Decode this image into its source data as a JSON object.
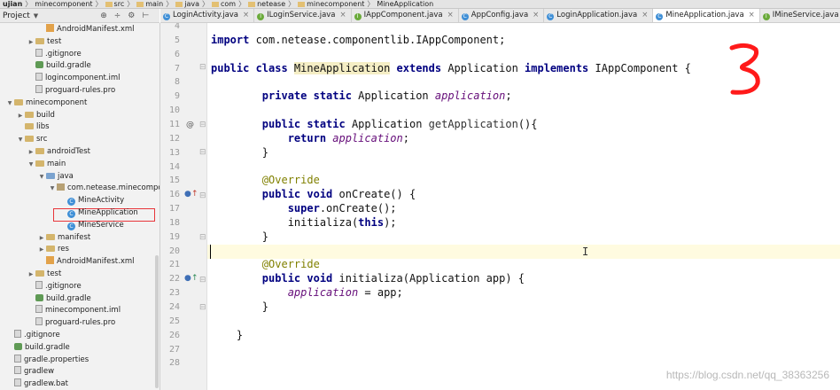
{
  "breadcrumb": [
    "ujian",
    "minecomponent",
    "src",
    "main",
    "java",
    "com",
    "netease",
    "minecomponent",
    "MineApplication"
  ],
  "project_panel": {
    "label": "Project"
  },
  "tabs": [
    {
      "label": "LoginActivity.java",
      "type": "class",
      "active": false
    },
    {
      "label": "ILoginService.java",
      "type": "interface",
      "active": false
    },
    {
      "label": "IAppComponent.java",
      "type": "interface",
      "active": false
    },
    {
      "label": "AppConfig.java",
      "type": "class",
      "active": false
    },
    {
      "label": "LoginApplication.java",
      "type": "class",
      "active": false
    },
    {
      "label": "MineApplication.java",
      "type": "class",
      "active": true
    },
    {
      "label": "IMineService.java",
      "type": "interface",
      "active": false
    },
    {
      "label": "Mi",
      "type": "class",
      "active": false
    }
  ],
  "tree": [
    {
      "label": "AndroidManifest.xml",
      "icon": "xml",
      "indent": 3
    },
    {
      "label": "test",
      "icon": "folder",
      "indent": 2,
      "arrow": "right"
    },
    {
      "label": ".gitignore",
      "icon": "file",
      "indent": 2
    },
    {
      "label": "build.gradle",
      "icon": "gradle",
      "indent": 2
    },
    {
      "label": "logincomponent.iml",
      "icon": "file",
      "indent": 2
    },
    {
      "label": "proguard-rules.pro",
      "icon": "file",
      "indent": 2
    },
    {
      "label": "minecomponent",
      "icon": "folder",
      "indent": 0,
      "arrow": "down"
    },
    {
      "label": "build",
      "icon": "folder",
      "indent": 1,
      "arrow": "right"
    },
    {
      "label": "libs",
      "icon": "folder",
      "indent": 1
    },
    {
      "label": "src",
      "icon": "folder",
      "indent": 1,
      "arrow": "down"
    },
    {
      "label": "androidTest",
      "icon": "folder",
      "indent": 2,
      "arrow": "right"
    },
    {
      "label": "main",
      "icon": "folder",
      "indent": 2,
      "arrow": "down"
    },
    {
      "label": "java",
      "icon": "folder-blue",
      "indent": 3,
      "arrow": "down"
    },
    {
      "label": "com.netease.minecomponent",
      "icon": "package",
      "indent": 4,
      "arrow": "down"
    },
    {
      "label": "MineActivity",
      "icon": "class",
      "indent": 5
    },
    {
      "label": "MineApplication",
      "icon": "class",
      "indent": 5
    },
    {
      "label": "MineService",
      "icon": "class",
      "indent": 5
    },
    {
      "label": "manifest",
      "icon": "folder",
      "indent": 3,
      "arrow": "right"
    },
    {
      "label": "res",
      "icon": "folder",
      "indent": 3,
      "arrow": "right"
    },
    {
      "label": "AndroidManifest.xml",
      "icon": "xml",
      "indent": 3
    },
    {
      "label": "test",
      "icon": "folder",
      "indent": 2,
      "arrow": "right"
    },
    {
      "label": ".gitignore",
      "icon": "file",
      "indent": 2
    },
    {
      "label": "build.gradle",
      "icon": "gradle",
      "indent": 2
    },
    {
      "label": "minecomponent.iml",
      "icon": "file",
      "indent": 2
    },
    {
      "label": "proguard-rules.pro",
      "icon": "file",
      "indent": 2
    },
    {
      "label": ".gitignore",
      "icon": "file",
      "indent": 0
    },
    {
      "label": "build.gradle",
      "icon": "gradle",
      "indent": 0
    },
    {
      "label": "gradle.properties",
      "icon": "file",
      "indent": 0
    },
    {
      "label": "gradlew",
      "icon": "file",
      "indent": 0
    },
    {
      "label": "gradlew.bat",
      "icon": "file",
      "indent": 0
    }
  ],
  "code": [
    {
      "n": "4",
      "parts": []
    },
    {
      "n": "5",
      "parts": [
        [
          "kw",
          "import "
        ],
        [
          "t",
          "com.netease.componentlib.IAppComponent;"
        ]
      ]
    },
    {
      "n": "6",
      "parts": []
    },
    {
      "n": "7",
      "parts": [
        [
          "kw",
          "public class "
        ],
        [
          "sel",
          "MineApplication"
        ],
        [
          "t",
          " "
        ],
        [
          "kw",
          "extends "
        ],
        [
          "t",
          "Application "
        ],
        [
          "kw",
          "implements "
        ],
        [
          "t",
          "IAppComponent {"
        ]
      ]
    },
    {
      "n": "8",
      "parts": []
    },
    {
      "n": "9",
      "parts": [
        [
          "t",
          "        "
        ],
        [
          "kw",
          "private static "
        ],
        [
          "t",
          "Application "
        ],
        [
          "fld",
          "application"
        ],
        [
          "t",
          ";"
        ]
      ]
    },
    {
      "n": "10",
      "parts": []
    },
    {
      "n": "11",
      "parts": [
        [
          "t",
          "        "
        ],
        [
          "kw",
          "public static "
        ],
        [
          "t",
          "Application "
        ],
        [
          "mth",
          "getApplication"
        ],
        [
          "t",
          "(){"
        ]
      ]
    },
    {
      "n": "12",
      "parts": [
        [
          "t",
          "            "
        ],
        [
          "kw",
          "return "
        ],
        [
          "fld",
          "application"
        ],
        [
          "t",
          ";"
        ]
      ]
    },
    {
      "n": "13",
      "parts": [
        [
          "t",
          "        }"
        ]
      ]
    },
    {
      "n": "14",
      "parts": []
    },
    {
      "n": "15",
      "parts": [
        [
          "t",
          "        "
        ],
        [
          "anno",
          "@Override"
        ]
      ]
    },
    {
      "n": "16",
      "parts": [
        [
          "t",
          "        "
        ],
        [
          "kw",
          "public void "
        ],
        [
          "t",
          "onCreate() {"
        ]
      ]
    },
    {
      "n": "17",
      "parts": [
        [
          "t",
          "            "
        ],
        [
          "kw",
          "super"
        ],
        [
          "t",
          ".onCreate();"
        ]
      ]
    },
    {
      "n": "18",
      "parts": [
        [
          "t",
          "            initializa("
        ],
        [
          "kw",
          "this"
        ],
        [
          "t",
          ");"
        ]
      ]
    },
    {
      "n": "19",
      "parts": [
        [
          "t",
          "        }"
        ]
      ]
    },
    {
      "n": "20",
      "parts": []
    },
    {
      "n": "21",
      "parts": [
        [
          "t",
          "        "
        ],
        [
          "anno",
          "@Override"
        ]
      ]
    },
    {
      "n": "22",
      "parts": [
        [
          "t",
          "        "
        ],
        [
          "kw",
          "public void "
        ],
        [
          "t",
          "initializa(Application app) {"
        ]
      ]
    },
    {
      "n": "23",
      "parts": [
        [
          "t",
          "            "
        ],
        [
          "fld",
          "application"
        ],
        [
          "t",
          " = app;"
        ]
      ]
    },
    {
      "n": "24",
      "parts": [
        [
          "t",
          "        }"
        ]
      ]
    },
    {
      "n": "25",
      "parts": []
    },
    {
      "n": "26",
      "parts": [
        [
          "t",
          "    }"
        ]
      ]
    },
    {
      "n": "27",
      "parts": []
    },
    {
      "n": "28",
      "parts": []
    }
  ],
  "annotation_number": "3",
  "watermark": "https://blog.csdn.net/qq_38363256",
  "colors": {
    "keyword": "#000080",
    "field": "#660e7a",
    "annotation": "#808000",
    "highlight_box": "#e8353a",
    "handwriting": "#ff1a1a"
  }
}
